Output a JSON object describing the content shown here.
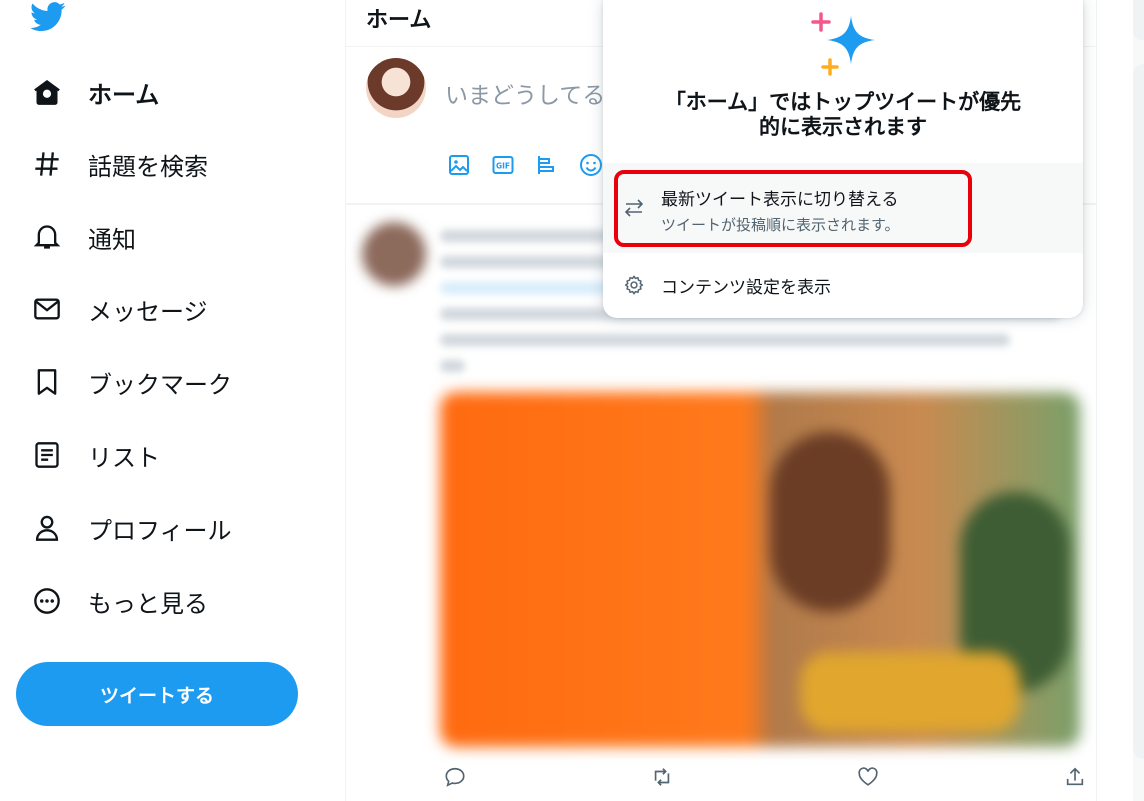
{
  "brand": {
    "logo_icon": "twitter-bird-icon",
    "accent": "#1d9bf0"
  },
  "sidebar": {
    "items": [
      {
        "label": "ホーム",
        "icon": "home-icon",
        "active": true
      },
      {
        "label": "話題を検索",
        "icon": "hashtag-icon"
      },
      {
        "label": "通知",
        "icon": "bell-icon"
      },
      {
        "label": "メッセージ",
        "icon": "envelope-icon"
      },
      {
        "label": "ブックマーク",
        "icon": "bookmark-icon"
      },
      {
        "label": "リスト",
        "icon": "list-icon"
      },
      {
        "label": "プロフィール",
        "icon": "person-icon"
      },
      {
        "label": "もっと見る",
        "icon": "more-circle-icon"
      }
    ],
    "tweet_button": "ツイートする"
  },
  "header": {
    "title": "ホーム"
  },
  "compose": {
    "placeholder": "いまどうしてる",
    "tools": [
      "image-icon",
      "gif-icon",
      "poll-icon",
      "emoji-icon"
    ]
  },
  "tweet": {
    "actions": [
      "reply-icon",
      "retweet-icon",
      "like-icon",
      "share-icon"
    ]
  },
  "popover": {
    "icon": "sparkle-icon",
    "title_line1": "「ホーム」ではトップツイートが優先",
    "title_line2": "的に表示されます",
    "switch_label": "最新ツイート表示に切り替える",
    "switch_sub": "ツイートが投稿順に表示されます。",
    "switch_icon": "swap-arrows-icon",
    "settings_label": "コンテンツ設定を表示",
    "settings_icon": "gear-icon",
    "highlight_color": "#e8000b"
  }
}
